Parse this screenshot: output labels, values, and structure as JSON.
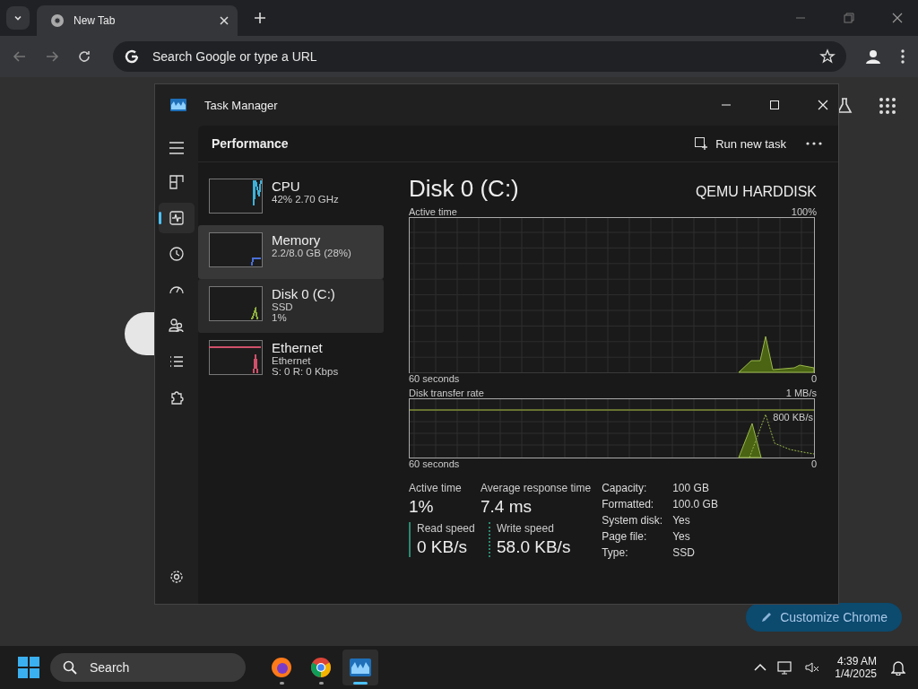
{
  "browser": {
    "tabs": [
      {
        "title": "New Tab",
        "selected": true
      }
    ],
    "address_placeholder": "Search Google or type a URL",
    "customize_button": "Customize Chrome"
  },
  "task_manager": {
    "title": "Task Manager",
    "page_title": "Performance",
    "run_new_task": "Run new task",
    "nav": [
      {
        "kind": "processes",
        "selected": false
      },
      {
        "kind": "performance",
        "selected": true
      },
      {
        "kind": "history",
        "selected": false
      },
      {
        "kind": "startup",
        "selected": false
      },
      {
        "kind": "users",
        "selected": false
      },
      {
        "kind": "details",
        "selected": false
      },
      {
        "kind": "services",
        "selected": false
      }
    ],
    "devices": [
      {
        "name": "CPU",
        "lines": [
          "42% 2.70 GHz"
        ],
        "color": "#3fb1d8",
        "selected": false,
        "hovered": false
      },
      {
        "name": "Memory",
        "lines": [
          "2.2/8.0 GB (28%)"
        ],
        "color": "#4a6fd6",
        "selected": false,
        "hovered": true
      },
      {
        "name": "Disk 0 (C:)",
        "lines": [
          "SSD",
          "1%"
        ],
        "color": "#8cae3c",
        "selected": true,
        "hovered": false
      },
      {
        "name": "Ethernet",
        "lines": [
          "Ethernet",
          "S: 0 R: 0 Kbps"
        ],
        "color": "#d0506a",
        "selected": false,
        "hovered": false
      }
    ],
    "detail": {
      "title": "Disk 0 (C:)",
      "model": "QEMU HARDDISK",
      "graphs": [
        {
          "kind": "active",
          "label": "Active time",
          "max": "100%",
          "span": "60 seconds",
          "min": "0"
        },
        {
          "kind": "transfer",
          "label": "Disk transfer rate",
          "max": "1 MB/s",
          "marker": "800 KB/s",
          "span": "60 seconds",
          "min": "0"
        }
      ],
      "stats": [
        {
          "label": "Active time",
          "value": "1%"
        },
        {
          "label": "Average response time",
          "value": "7.4 ms"
        }
      ],
      "speeds": [
        {
          "kind": "read",
          "label": "Read speed",
          "value": "0 KB/s"
        },
        {
          "kind": "write",
          "label": "Write speed",
          "value": "58.0 KB/s"
        }
      ],
      "properties": [
        {
          "label": "Capacity:",
          "value": "100 GB"
        },
        {
          "label": "Formatted:",
          "value": "100.0 GB"
        },
        {
          "label": "System disk:",
          "value": "Yes"
        },
        {
          "label": "Page file:",
          "value": "Yes"
        },
        {
          "label": "Type:",
          "value": "SSD"
        }
      ]
    }
  },
  "taskbar": {
    "search_placeholder": "Search",
    "apps": [
      {
        "kind": "firefox",
        "selected": false
      },
      {
        "kind": "chrome",
        "selected": false
      },
      {
        "kind": "taskmanager",
        "selected": true
      }
    ],
    "time": "4:39 AM",
    "date": "1/4/2025"
  }
}
